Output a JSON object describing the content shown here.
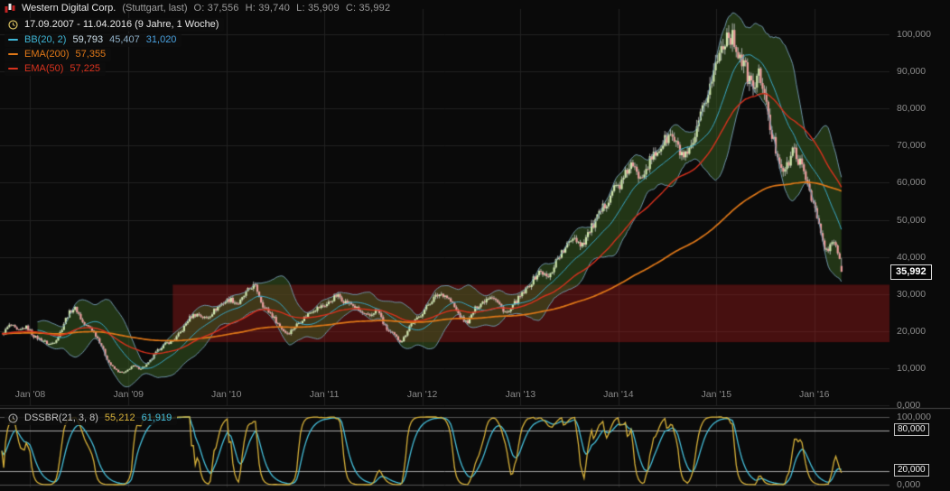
{
  "header": {
    "title": "Western Digital Corp.",
    "subtitle": "(Stuttgart, last)",
    "open": "O: 37,556",
    "high": "H: 39,740",
    "low": "L: 35,909",
    "close": "C: 35,992",
    "date_range": "17.09.2007 - 11.04.2016 (9 Jahre, 1 Woche)"
  },
  "legend": {
    "bb": {
      "label": "BB(20, 2)",
      "v1": "59,793",
      "v2": "45,407",
      "v3": "31,020"
    },
    "ema200": {
      "label": "EMA(200)",
      "value": "57,355"
    },
    "ema50": {
      "label": "EMA(50)",
      "value": "57,225"
    }
  },
  "main_axis": {
    "ticks": [
      "100,000",
      "90,000",
      "80,000",
      "70,000",
      "60,000",
      "50,000",
      "40,000",
      "30,000",
      "20,000",
      "10,000",
      "0,000"
    ],
    "price_marker": "35,992"
  },
  "x_axis": {
    "ticks": [
      "Jan '08",
      "Jan '09",
      "Jan '10",
      "Jan '11",
      "Jan '12",
      "Jan '13",
      "Jan '14",
      "Jan '15",
      "Jan '16"
    ]
  },
  "indicator": {
    "label": "DSSBR(21, 3, 8)",
    "value1": "55,212",
    "value2": "61,919",
    "ticks": [
      {
        "label": "100,000",
        "value": 100,
        "boxed": false
      },
      {
        "label": "80,000",
        "value": 80,
        "boxed": true
      },
      {
        "label": "20,000",
        "value": 20,
        "boxed": true
      },
      {
        "label": "0,000",
        "value": 0,
        "boxed": false
      }
    ]
  },
  "chart_data": {
    "type": "candlestick",
    "title": "Western Digital Corp. (Stuttgart, last)",
    "interval": "weekly",
    "date_start": "2007-09-17",
    "date_end": "2016-04-11",
    "duration_label": "9 Jahre, 1 Woche",
    "ylim": [
      0,
      100000
    ],
    "y_tick_step": 10000,
    "x_tick_years": [
      2008,
      2009,
      2010,
      2011,
      2012,
      2013,
      2014,
      2015,
      2016
    ],
    "monthly_start": "2007-09",
    "monthly_closes": [
      19000,
      21500,
      20000,
      21000,
      18500,
      17500,
      16500,
      19000,
      24000,
      26000,
      22000,
      20500,
      17000,
      12000,
      9500,
      8800,
      10500,
      10000,
      11500,
      14500,
      16500,
      17500,
      20000,
      23500,
      24500,
      23500,
      25500,
      27500,
      28500,
      27500,
      30500,
      32000,
      27000,
      24500,
      21500,
      19500,
      21500,
      23500,
      25500,
      26500,
      27500,
      29500,
      28000,
      27000,
      25000,
      24000,
      25500,
      21000,
      19000,
      17500,
      21500,
      23500,
      26500,
      29000,
      30000,
      28000,
      24500,
      22500,
      26000,
      28000,
      29500,
      27000,
      25000,
      28000,
      30500,
      33500,
      36000,
      34500,
      39500,
      42000,
      45500,
      43500,
      47000,
      50500,
      54500,
      58500,
      60000,
      64500,
      62000,
      64500,
      67500,
      70500,
      72500,
      68500,
      67000,
      72500,
      80500,
      88000,
      95500,
      100000,
      96500,
      91000,
      86000,
      88500,
      76000,
      68000,
      63500,
      68500,
      64000,
      58000,
      49500,
      41500,
      44000,
      35992
    ],
    "last_candle": {
      "open": 37556,
      "high": 39740,
      "low": 35909,
      "close": 35992
    },
    "overlays": {
      "bollinger": {
        "period": 20,
        "deviation": 2,
        "upper": 59793,
        "middle": 45407,
        "lower": 31020,
        "band_fill": "#3a6022",
        "line_color": "#6e93a8"
      },
      "ema200": {
        "period": 200,
        "value": 57355,
        "color": "#e07818"
      },
      "ema50": {
        "period": 50,
        "value": 57225,
        "color": "#d8321e"
      }
    },
    "zone": {
      "start_week": 91,
      "top": 32500,
      "bottom": 17000,
      "color": "rgba(163,24,24,0.40)"
    },
    "indicator": {
      "name": "DSSBR",
      "params": [
        21,
        3,
        8
      ],
      "last_values": [
        55.212,
        61.919
      ],
      "levels": [
        80,
        20
      ],
      "range": [
        0,
        100
      ],
      "colors": {
        "line1": "#d8b23a",
        "line2": "#46c0dc"
      }
    },
    "colors": {
      "background": "#0a0a0a",
      "grid": "#232323",
      "candle_up": "#cfe6ad",
      "candle_down": "#eb9d9d",
      "wick": "#c8c8c8"
    }
  }
}
